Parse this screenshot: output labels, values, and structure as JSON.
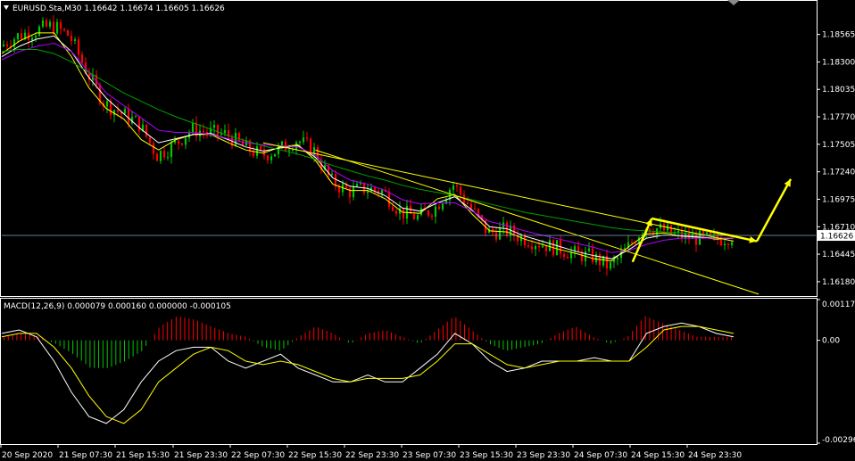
{
  "colors": {
    "background": "#000000",
    "foreground": "#ffffff",
    "bull_candle": "#00c800",
    "bear_candle": "#ff0000",
    "ma_fast": "#ffff00",
    "ma_mid": "#ffffff",
    "ma_slow": "#b000ff",
    "ma_long": "#00a000",
    "trendline": "#ffff00",
    "arrow": "#ffff00",
    "price_line": "#8aa6c8",
    "macd_pos": "#ff0000",
    "macd_neg": "#00c800",
    "macd_main": "#ffffff",
    "macd_signal": "#ffff00"
  },
  "header": {
    "icon": "triangle-down-icon",
    "title": "EURUSD.Sta,M30  1.16642 1.16674 1.16605 1.16626"
  },
  "chart_data": [
    {
      "type": "candlestick",
      "title": "EURUSD.Sta,M30  1.16642 1.16674 1.16605 1.16626",
      "symbol": "EURUSD.Sta",
      "timeframe": "M30",
      "ohlc_current": {
        "open": 1.16642,
        "high": 1.16674,
        "low": 1.16605,
        "close": 1.16626
      },
      "current_price_label": "1.16626",
      "ylim": [
        1.1605,
        1.1888
      ],
      "y_ticks": [
        "1.18565",
        "1.18300",
        "1.18035",
        "1.17770",
        "1.17505",
        "1.17240",
        "1.16975",
        "1.16710",
        "1.16445",
        "1.16180"
      ],
      "x_ticks": [
        "20 Sep 2020",
        "21 Sep 07:30",
        "21 Sep 15:30",
        "21 Sep 23:30",
        "22 Sep 07:30",
        "22 Sep 15:30",
        "22 Sep 23:30",
        "23 Sep 07:30",
        "23 Sep 15:30",
        "23 Sep 23:30",
        "24 Sep 07:30",
        "24 Sep 15:30",
        "24 Sep 23:30"
      ],
      "close_path": [
        1.1845,
        1.1855,
        1.186,
        1.1865,
        1.1855,
        1.182,
        1.179,
        1.178,
        1.177,
        1.174,
        1.175,
        1.1765,
        1.1762,
        1.176,
        1.1748,
        1.174,
        1.1745,
        1.1755,
        1.1745,
        1.1715,
        1.1705,
        1.1708,
        1.1705,
        1.1685,
        1.168,
        1.169,
        1.1712,
        1.169,
        1.1665,
        1.1668,
        1.166,
        1.1655,
        1.165,
        1.1645,
        1.1642,
        1.1632,
        1.165,
        1.1672,
        1.1668,
        1.1662,
        1.166,
        1.1658,
        1.1662
      ],
      "series": [
        {
          "name": "",
          "color": "#ffff00",
          "values": [
            1.1838,
            1.185,
            1.1858,
            1.1858,
            1.1835,
            1.1805,
            1.1785,
            1.1775,
            1.1755,
            1.1745,
            1.1755,
            1.176,
            1.176,
            1.1752,
            1.1745,
            1.1742,
            1.1748,
            1.175,
            1.1735,
            1.1712,
            1.1706,
            1.1706,
            1.1698,
            1.1685,
            1.1684,
            1.1698,
            1.1702,
            1.1683,
            1.1667,
            1.1666,
            1.1659,
            1.1654,
            1.1649,
            1.1645,
            1.164,
            1.1638,
            1.1652,
            1.1664,
            1.1665,
            1.1662,
            1.1661,
            1.1659,
            1.166
          ]
        },
        {
          "name": "",
          "color": "#ffffff",
          "values": [
            1.1835,
            1.1845,
            1.1852,
            1.1855,
            1.184,
            1.1815,
            1.1795,
            1.178,
            1.1765,
            1.1752,
            1.1756,
            1.176,
            1.1761,
            1.1755,
            1.1748,
            1.1744,
            1.1747,
            1.1749,
            1.1738,
            1.1718,
            1.171,
            1.1708,
            1.1701,
            1.1689,
            1.1686,
            1.1694,
            1.17,
            1.1687,
            1.1671,
            1.1669,
            1.1662,
            1.1657,
            1.1652,
            1.1647,
            1.1643,
            1.164,
            1.1649,
            1.166,
            1.1663,
            1.1662,
            1.1661,
            1.166,
            1.166
          ]
        },
        {
          "name": "",
          "color": "#b000ff",
          "values": [
            1.1832,
            1.184,
            1.1845,
            1.1848,
            1.184,
            1.182,
            1.18,
            1.1788,
            1.1776,
            1.1764,
            1.1762,
            1.1762,
            1.176,
            1.1756,
            1.1752,
            1.175,
            1.1749,
            1.1748,
            1.174,
            1.1725,
            1.1716,
            1.1712,
            1.1706,
            1.1697,
            1.1693,
            1.1694,
            1.1694,
            1.1686,
            1.1676,
            1.1672,
            1.1667,
            1.1663,
            1.1659,
            1.1655,
            1.1651,
            1.1646,
            1.1648,
            1.1654,
            1.1658,
            1.166,
            1.166,
            1.166,
            1.166
          ]
        },
        {
          "name": "",
          "color": "#00a000",
          "values": [
            1.184,
            1.1842,
            1.1842,
            1.1838,
            1.183,
            1.182,
            1.181,
            1.18,
            1.1792,
            1.1784,
            1.1777,
            1.1771,
            1.1765,
            1.1759,
            1.1754,
            1.1749,
            1.1745,
            1.1741,
            1.1736,
            1.173,
            1.1725,
            1.172,
            1.1716,
            1.1711,
            1.1707,
            1.1704,
            1.1701,
            1.1697,
            1.1693,
            1.1689,
            1.1685,
            1.1682,
            1.1679,
            1.1676,
            1.1673,
            1.167,
            1.1668,
            1.1667,
            1.1666,
            1.1665,
            1.1664,
            1.1663,
            1.1663
          ]
        }
      ]
    },
    {
      "type": "macd_histogram",
      "title": "MACD(12,26,9) 0.000079 0.000160 0.000000 -0.000105",
      "ylim": [
        -0.002969,
        0.001176
      ],
      "y_ticks": [
        "0.001176",
        "0.00",
        "-0.002969"
      ],
      "histogram": [
        0.0001,
        0.0002,
        0.0001,
        -0.0001,
        -0.0004,
        -0.0008,
        -0.0008,
        -0.0006,
        -0.0003,
        0.0004,
        0.0007,
        0.0006,
        0.0004,
        0.0002,
        0.0001,
        -0.0002,
        -0.0003,
        0.0001,
        0.0004,
        0.0002,
        -0.0001,
        0.0002,
        0.0003,
        0.0001,
        -0.0001,
        0.0003,
        0.0007,
        0.0003,
        -0.0001,
        -0.0003,
        -0.0002,
        -0.0001,
        0.0002,
        0.0004,
        0.0001,
        -0.0001,
        0.0001,
        0.0007,
        0.0005,
        0.0003,
        0.0001,
        0.0001,
        0.0001
      ],
      "series": [
        {
          "name": "",
          "color": "#ffffff",
          "values": [
            0.0002,
            0.0003,
            0.0001,
            -0.0006,
            -0.0015,
            -0.0022,
            -0.0024,
            -0.002,
            -0.0012,
            -0.0006,
            -0.0003,
            -0.0002,
            -0.0002,
            -0.0006,
            -0.0008,
            -0.0006,
            -0.0004,
            -0.0008,
            -0.001,
            -0.0012,
            -0.0012,
            -0.001,
            -0.0012,
            -0.0012,
            -0.0008,
            -0.0004,
            0.0002,
            -0.0001,
            -0.0006,
            -0.0009,
            -0.0008,
            -0.0006,
            -0.0006,
            -0.0006,
            -0.0005,
            -0.0006,
            -0.0006,
            0.0002,
            0.0004,
            0.0005,
            0.0004,
            0.0002,
            0.0001
          ]
        },
        {
          "name": "",
          "color": "#ffff00",
          "values": [
            0.0001,
            0.0002,
            0.0002,
            -0.0002,
            -0.0008,
            -0.0016,
            -0.0022,
            -0.0024,
            -0.002,
            -0.0012,
            -0.0008,
            -0.0004,
            -0.0002,
            -0.0003,
            -0.0006,
            -0.0007,
            -0.0006,
            -0.0007,
            -0.0009,
            -0.0011,
            -0.0012,
            -0.0011,
            -0.0011,
            -0.0011,
            -0.001,
            -0.0006,
            -0.0001,
            -0.0001,
            -0.0004,
            -0.0007,
            -0.0008,
            -0.0007,
            -0.0006,
            -0.0006,
            -0.0006,
            -0.0006,
            -0.0006,
            -0.0002,
            0.0003,
            0.0004,
            0.0004,
            0.0003,
            0.0002
          ]
        }
      ]
    }
  ]
}
